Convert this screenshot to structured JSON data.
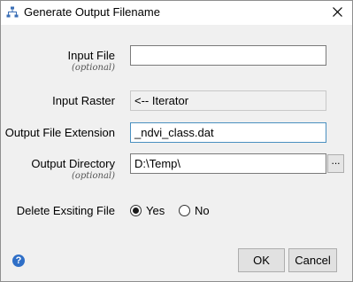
{
  "window": {
    "title": "Generate Output Filename",
    "icon": "tool-icon",
    "close_icon": "close-icon"
  },
  "form": {
    "input_file": {
      "label": "Input File",
      "sub": "(optional)",
      "value": ""
    },
    "input_raster": {
      "label": "Input Raster",
      "value": "<-- Iterator"
    },
    "output_extension": {
      "label": "Output File Extension",
      "value": "_ndvi_class.dat"
    },
    "output_directory": {
      "label": "Output Directory",
      "sub": "(optional)",
      "value": "D:\\Temp\\",
      "browse_label": "..."
    },
    "delete_existing": {
      "label": "Delete Exsiting File",
      "options": [
        "Yes",
        "No"
      ],
      "selected": "Yes"
    }
  },
  "footer": {
    "help_icon": "help-icon",
    "help_glyph": "?",
    "ok_label": "OK",
    "cancel_label": "Cancel"
  },
  "colors": {
    "accent_border": "#4a90c0",
    "help_blue": "#2f6fc7"
  }
}
